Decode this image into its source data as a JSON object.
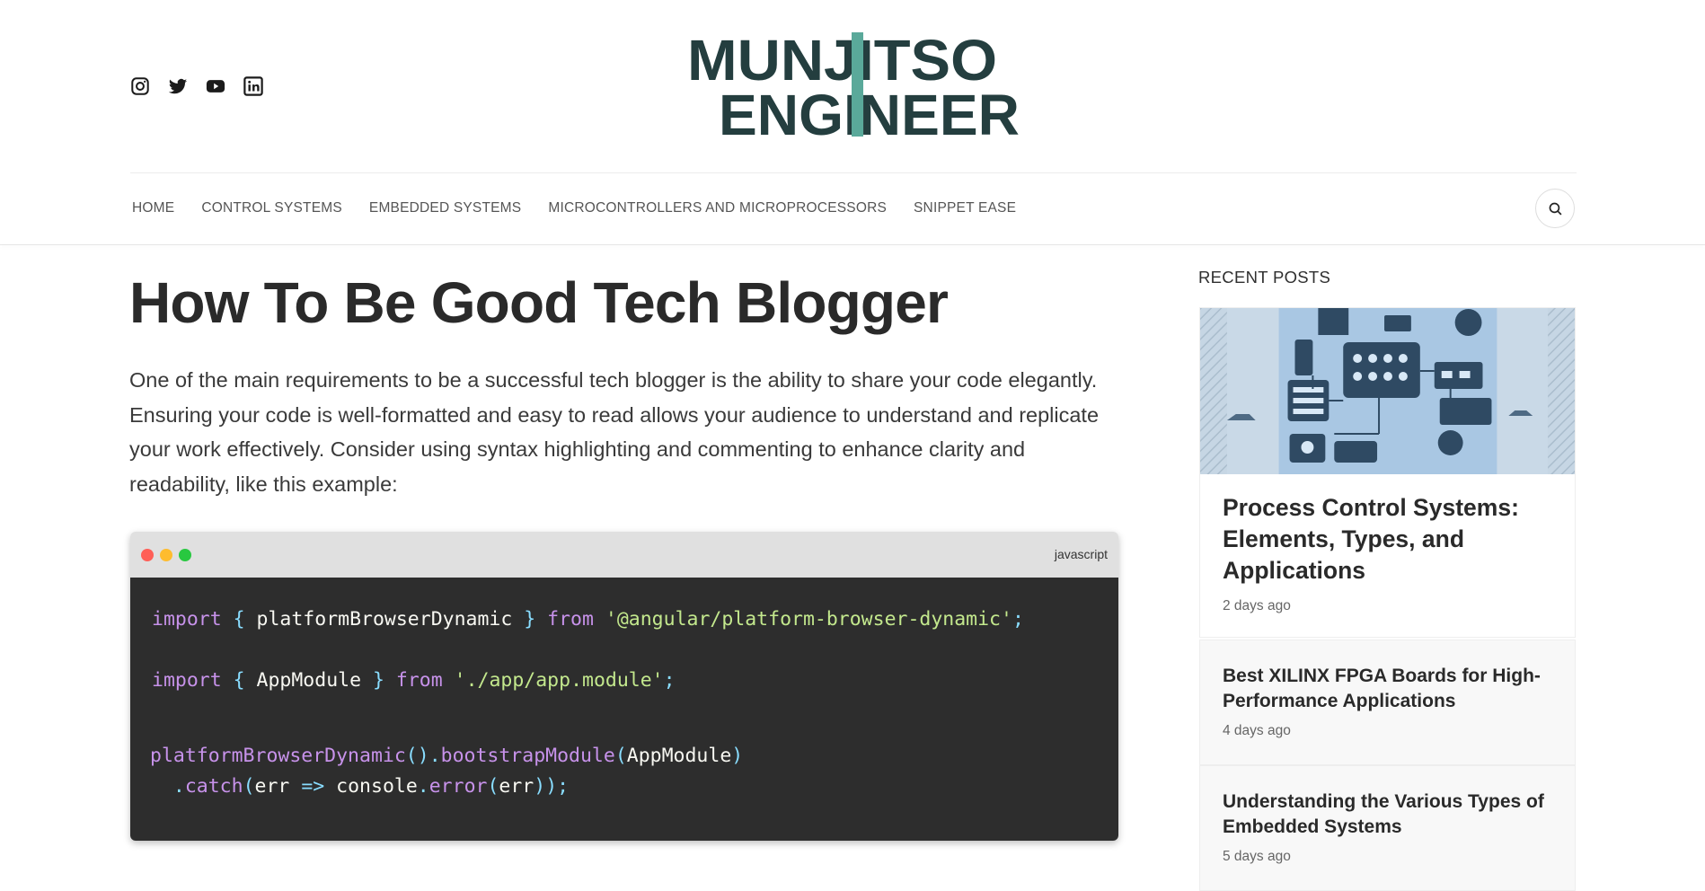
{
  "header": {
    "social_icons": [
      "instagram-icon",
      "twitter-icon",
      "youtube-icon",
      "linkedin-icon"
    ],
    "logo": {
      "line1": "MUNJITSO",
      "line2": "ENGINEER",
      "colors": {
        "dark": "#243e3f",
        "accent": "#5aa99a"
      }
    }
  },
  "nav": {
    "items": [
      "HOME",
      "CONTROL SYSTEMS",
      "EMBEDDED SYSTEMS",
      "MICROCONTROLLERS AND MICROPROCESSORS",
      "SNIPPET EASE"
    ],
    "search_icon": "search-icon"
  },
  "article": {
    "title": "How To Be Good Tech Blogger",
    "intro": "One of the main requirements to be a successful tech blogger is the ability to share your code elegantly. Ensuring your code is well-formatted and easy to read allows your audience to understand and replicate your work effectively. Consider using syntax highlighting and commenting to enhance clarity and readability, like this example:",
    "code": {
      "language": "javascript",
      "lines": [
        "import { platformBrowserDynamic } from '@angular/platform-browser-dynamic';",
        "import { AppModule } from './app/app.module';",
        "platformBrowserDynamic().bootstrapModule(AppModule)",
        "  .catch(err => console.error(err));"
      ]
    }
  },
  "sidebar": {
    "title": "RECENT POSTS",
    "posts": [
      {
        "title": "Process Control Systems: Elements, Types, and Applications",
        "date": "2 days ago"
      },
      {
        "title": "Best XILINX FPGA Boards for High-Performance Applications",
        "date": "4 days ago"
      },
      {
        "title": "Understanding the Various Types of Embedded Systems",
        "date": "5 days ago"
      }
    ]
  },
  "colors": {
    "code_bg": "#2d2d2d",
    "code_header_bg": "#e0e0e0",
    "keyword": "#c792ea",
    "string": "#c3e88d",
    "punctuation": "#89ddff",
    "image_bg": "#bcd3e6"
  }
}
